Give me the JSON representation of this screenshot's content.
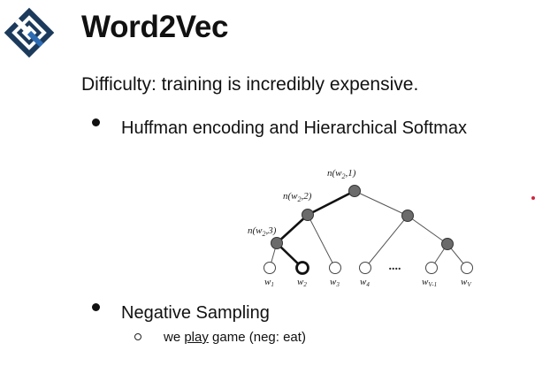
{
  "slide": {
    "title": "Word2Vec",
    "intro": "Difficulty: training is incredibly expensive.",
    "bullets": [
      {
        "text": "Huffman encoding and Hierarchical Softmax"
      },
      {
        "text": "Negative Sampling"
      }
    ],
    "sub_bullet": {
      "before": "we ",
      "underlined": "play",
      "after": " game (neg: eat)"
    },
    "logo_icon": "brand-logo-icon",
    "accent_dot_color": "#d0243e"
  },
  "tree_figure": {
    "node_labels": {
      "root": "n(w",
      "root_sub": "2",
      "root_rest": ",1)",
      "mid": "n(w",
      "mid_sub": "2",
      "mid_rest": ",2)",
      "low": "n(w",
      "low_sub": "2",
      "low_rest": ",3)"
    },
    "leaves": [
      {
        "base": "w",
        "sub": "1"
      },
      {
        "base": "w",
        "sub": "2"
      },
      {
        "base": "w",
        "sub": "3"
      },
      {
        "base": "w",
        "sub": "4"
      },
      {
        "base": "w",
        "sub": "V-1"
      },
      {
        "base": "w",
        "sub": "V"
      }
    ],
    "ellipsis": "....",
    "colors": {
      "inner_node": "#6b6b6b",
      "path_edge": "#111111",
      "edge": "#555555"
    }
  }
}
